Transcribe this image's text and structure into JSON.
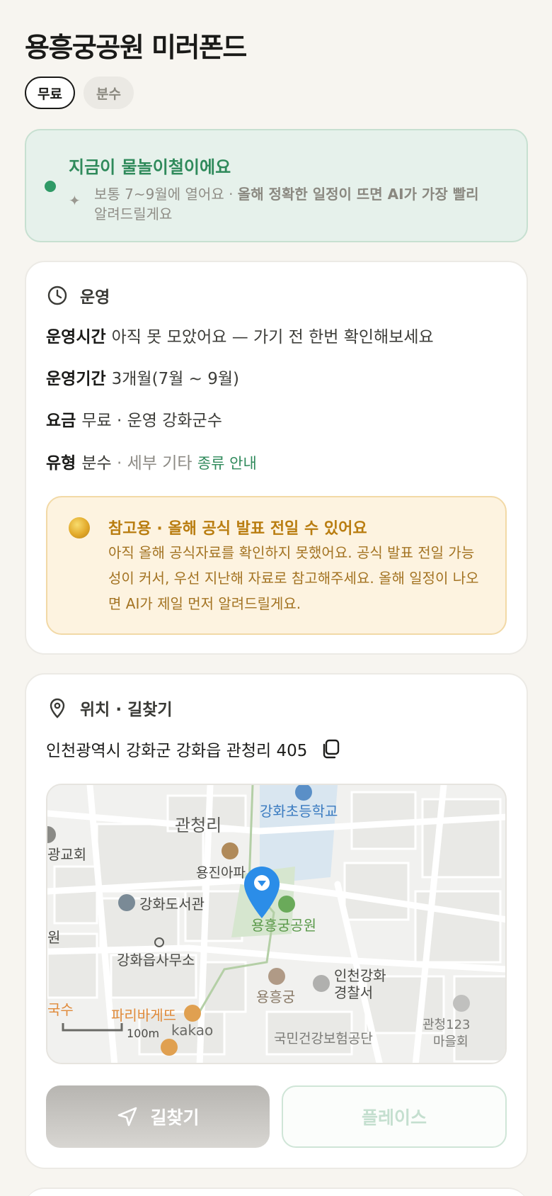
{
  "header": {
    "title": "용흥궁공원 미러폰드",
    "chips": [
      "무료",
      "분수"
    ]
  },
  "season": {
    "headline": "지금이 물놀이철이에요",
    "desc_prefix": "보통 7~9월에 열어요 · ",
    "desc_bold": "올해 정확한 일정이 뜨면 AI가 가장 빨리",
    "desc_suffix": "알려드릴게요",
    "colors": {
      "accent": "#2f8a5b",
      "bg": "#e6f1eb"
    }
  },
  "operation": {
    "section_title": "운영",
    "hours_key": "운영시간",
    "hours_val": "아직 못 모았어요 — 가기 전 한번 확인해보세요",
    "period_key": "운영기간",
    "period_val": "3개월(7월 ~ 9월)",
    "fee_key": "요금",
    "fee_val": "무료 · 운영 강화군수",
    "type_key": "유형",
    "type_val": "분수",
    "type_sub": " · 세부 기타 ",
    "type_link": "종류 안내"
  },
  "notice": {
    "head": "참고용 · 올해 공식 발표 전일 수 있어요",
    "body": "아직 올해 공식자료를 확인하지 못했어요. 공식 발표 전일 가능성이 커서, 우선 지난해 자료로 참고해주세요. 올해 일정이 나오면 AI가 제일 먼저 알려드릴게요.",
    "colors": {
      "text": "#b97d10",
      "bg": "#fdf3e0"
    }
  },
  "location": {
    "section_title": "위치 · 길찾기",
    "address": "인천광역시 강화군 강화읍 관청리 405",
    "map_labels": {
      "district": "관청리",
      "school": "강화초등학교",
      "church": "광교회",
      "apt": "용진아파",
      "library": "강화도서관",
      "park": "용흥궁공원",
      "won": "원",
      "office": "강화읍사무소",
      "palace": "용흥궁",
      "police1": "인천강화",
      "police2": "경찰서",
      "noodle": "국수",
      "bakery": "파리바게뜨",
      "scale": "100m",
      "kakao": "kakao",
      "nhis": "국민건강보험공단",
      "gwan1": "관청123",
      "gwan2": "마을회"
    }
  },
  "actions": {
    "route": "길찾기",
    "place": "플레이스"
  }
}
